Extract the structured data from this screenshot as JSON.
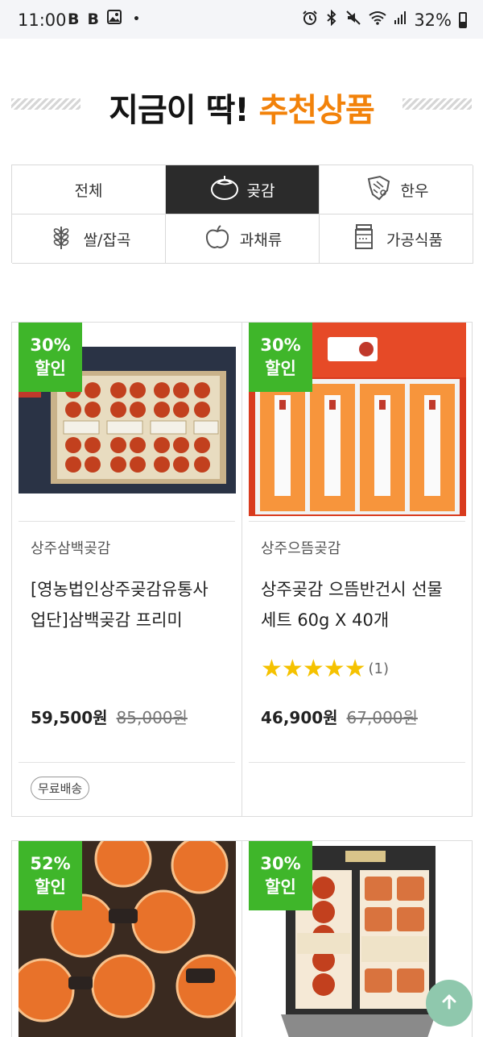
{
  "status_bar": {
    "time": "11:00",
    "left_icons": [
      "B",
      "B",
      "image-icon",
      "•"
    ],
    "battery": "32%"
  },
  "section_title": {
    "part1": "지금이 딱! ",
    "part2": "추천상품",
    "accent_color": "#f2820a"
  },
  "categories": [
    {
      "label": "전체",
      "icon": "",
      "active": false
    },
    {
      "label": "곶감",
      "icon": "persimmon-icon",
      "active": true
    },
    {
      "label": "한우",
      "icon": "beef-icon",
      "active": false
    },
    {
      "label": "쌀/잡곡",
      "icon": "grain-icon",
      "active": false
    },
    {
      "label": "과채류",
      "icon": "apple-icon",
      "active": false
    },
    {
      "label": "가공식품",
      "icon": "jar-icon",
      "active": false
    }
  ],
  "products": [
    {
      "discount": "30%",
      "discount_suffix": "할인",
      "brand": "상주삼백곶감",
      "name": "[영농법인상주곶감유통사업단]삼백곶감 프리미",
      "rating_count": "",
      "price": "59,500원",
      "original_price": "85,000원",
      "tag": "무료배송"
    },
    {
      "discount": "30%",
      "discount_suffix": "할인",
      "brand": "상주으뜸곶감",
      "name": "상주곶감 으뜸반건시 선물세트 60g X 40개",
      "rating_count": "(1)",
      "price": "46,900원",
      "original_price": "67,000원",
      "tag": ""
    },
    {
      "discount": "52%",
      "discount_suffix": "할인"
    },
    {
      "discount": "30%",
      "discount_suffix": "할인"
    }
  ],
  "colors": {
    "badge_green": "#3fb62a",
    "active_category_bg": "#2b2b2b",
    "star_yellow": "#f5c200",
    "scroll_top_bg": "#8fc8ad"
  }
}
